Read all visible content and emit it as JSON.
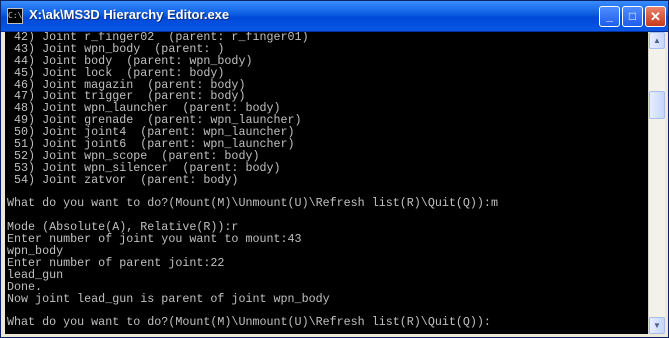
{
  "window": {
    "title": "X:\\ak\\MS3D Hierarchy Editor.exe",
    "icon_label": "C:\\"
  },
  "title_buttons": {
    "minimize": "_",
    "maximize": "□",
    "close": "✕"
  },
  "console": {
    "lines": [
      " 42) Joint r_finger02  (parent: r_finger01)",
      " 43) Joint wpn_body  (parent: )",
      " 44) Joint body  (parent: wpn_body)",
      " 45) Joint lock  (parent: body)",
      " 46) Joint magazin  (parent: body)",
      " 47) Joint trigger  (parent: body)",
      " 48) Joint wpn_launcher  (parent: body)",
      " 49) Joint grenade  (parent: wpn_launcher)",
      " 50) Joint joint4  (parent: wpn_launcher)",
      " 51) Joint joint6  (parent: wpn_launcher)",
      " 52) Joint wpn_scope  (parent: body)",
      " 53) Joint wpn_silencer  (parent: body)",
      " 54) Joint zatvor  (parent: body)",
      "",
      "What do you want to do?(Mount(M)\\Unmount(U)\\Refresh list(R)\\Quit(Q)):m",
      "",
      "Mode (Absolute(A), Relative(R)):r",
      "Enter number of joint you want to mount:43",
      "wpn_body",
      "Enter number of parent joint:22",
      "lead_gun",
      "Done.",
      "Now joint lead_gun is parent of joint wpn_body",
      "",
      "What do you want to do?(Mount(M)\\Unmount(U)\\Refresh list(R)\\Quit(Q)):"
    ]
  },
  "scrollbar": {
    "up_icon": "▲",
    "down_icon": "▼",
    "position": 0.2
  }
}
